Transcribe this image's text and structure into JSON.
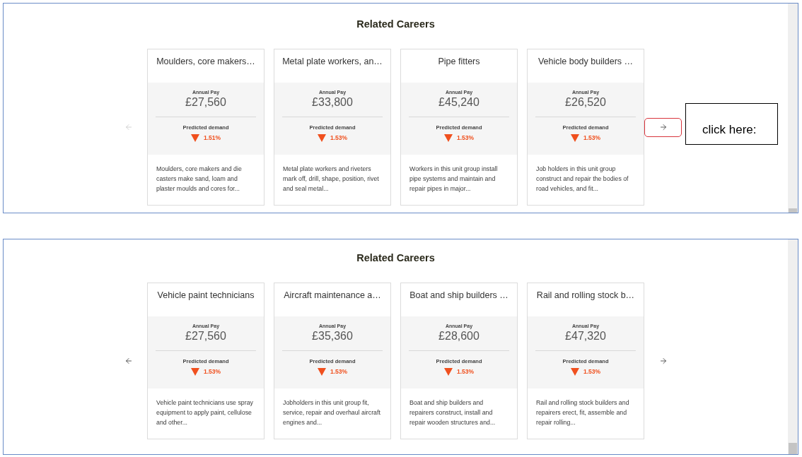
{
  "panels": [
    {
      "title": "Related Careers",
      "prev_button": {
        "disabled": true
      },
      "next_button": {
        "disabled": false,
        "highlighted": true
      },
      "callout": "click here:",
      "cards": [
        {
          "title": "Moulders, core makers…",
          "pay_label": "Annual Pay",
          "pay": "£27,560",
          "demand_label": "Predicted demand",
          "falling": true,
          "demand": "1.51%",
          "description": "Moulders, core makers and die casters make sand, loam and plaster moulds and cores for..."
        },
        {
          "title": "Metal plate workers, an…",
          "pay_label": "Annual Pay",
          "pay": "£33,800",
          "demand_label": "Predicted demand",
          "falling": true,
          "demand": "1.53%",
          "description": "Metal plate workers and riveters mark off, drill, shape, position, rivet and seal metal..."
        },
        {
          "title": "Pipe fitters",
          "pay_label": "Annual Pay",
          "pay": "£45,240",
          "demand_label": "Predicted demand",
          "falling": true,
          "demand": "1.53%",
          "description": "Workers in this unit group install pipe systems and maintain and repair pipes in major..."
        },
        {
          "title": "Vehicle body builders …",
          "pay_label": "Annual Pay",
          "pay": "£26,520",
          "demand_label": "Predicted demand",
          "falling": true,
          "demand": "1.53%",
          "description": "Job holders in this unit group construct and repair the bodies of road vehicles, and fit..."
        }
      ]
    },
    {
      "title": "Related Careers",
      "prev_button": {
        "disabled": false
      },
      "next_button": {
        "disabled": false,
        "highlighted": false
      },
      "cards": [
        {
          "title": "Vehicle paint technicians",
          "pay_label": "Annual Pay",
          "pay": "£27,560",
          "demand_label": "Predicted demand",
          "falling": true,
          "demand": "1.53%",
          "description": "Vehicle paint technicians use spray equipment to apply paint, cellulose and other..."
        },
        {
          "title": "Aircraft maintenance a…",
          "pay_label": "Annual Pay",
          "pay": "£35,360",
          "demand_label": "Predicted demand",
          "falling": true,
          "demand": "1.53%",
          "description": "Jobholders in this unit group fit, service, repair and overhaul aircraft engines and..."
        },
        {
          "title": "Boat and ship builders …",
          "pay_label": "Annual Pay",
          "pay": "£28,600",
          "demand_label": "Predicted demand",
          "falling": true,
          "demand": "1.53%",
          "description": "Boat and ship builders and repairers construct, install and repair wooden structures and..."
        },
        {
          "title": "Rail and rolling stock b…",
          "pay_label": "Annual Pay",
          "pay": "£47,320",
          "demand_label": "Predicted demand",
          "falling": true,
          "demand": "1.53%",
          "description": "Rail and rolling stock builders and repairers erect, fit, assemble and repair rolling..."
        }
      ]
    }
  ]
}
